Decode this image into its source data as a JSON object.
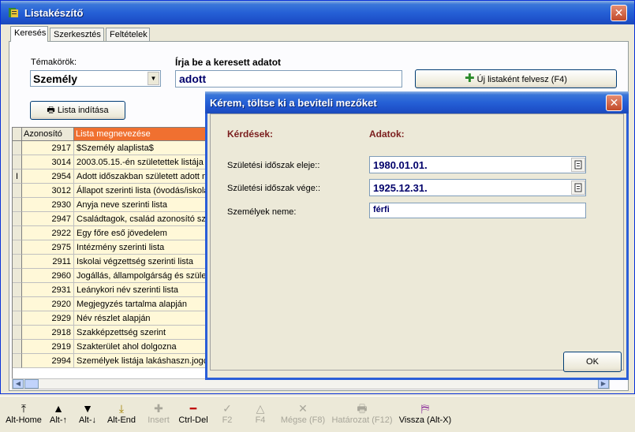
{
  "window": {
    "title": "Listakészítő"
  },
  "tabs": [
    {
      "label": "Keresés"
    },
    {
      "label": "Szerkesztés"
    },
    {
      "label": "Feltételek"
    }
  ],
  "search": {
    "topics_label": "Témakörök:",
    "topic_value": "Személy",
    "query_label": "Írja be a keresett adatot",
    "query_value": "adott",
    "new_list_label": "Új listaként felvesz  (F4)",
    "run_list_label": "Lista indítása"
  },
  "grid": {
    "columns": [
      "Azonosító",
      "Lista megnevezése"
    ],
    "rows": [
      {
        "id": "2917",
        "name": "$Személy alaplista$",
        "indicator": ""
      },
      {
        "id": "3014",
        "name": "2003.05.15.-én születettek listája",
        "indicator": ""
      },
      {
        "id": "2954",
        "name": "Adott időszakban született adott ne",
        "indicator": "I"
      },
      {
        "id": "3012",
        "name": "Állapot szerinti lista (óvodás/iskolás",
        "indicator": ""
      },
      {
        "id": "2930",
        "name": "Anyja neve szerinti lista",
        "indicator": ""
      },
      {
        "id": "2947",
        "name": "Családtagok, család azonosító szár",
        "indicator": ""
      },
      {
        "id": "2922",
        "name": "Egy főre eső jövedelem",
        "indicator": ""
      },
      {
        "id": "2975",
        "name": "Intézmény szerinti lista",
        "indicator": ""
      },
      {
        "id": "2911",
        "name": "Iskolai végzettség szerinti lista",
        "indicator": ""
      },
      {
        "id": "2960",
        "name": "Jogállás, állampolgárság és születé:",
        "indicator": ""
      },
      {
        "id": "2931",
        "name": "Leánykori név szerinti lista",
        "indicator": ""
      },
      {
        "id": "2920",
        "name": "Megjegyzés tartalma alapján",
        "indicator": ""
      },
      {
        "id": "2929",
        "name": "Név részlet alapján",
        "indicator": ""
      },
      {
        "id": "2918",
        "name": "Szakképzettség szerint",
        "indicator": ""
      },
      {
        "id": "2919",
        "name": "Szakterület ahol dolgozna",
        "indicator": ""
      },
      {
        "id": "2994",
        "name": "Személyek listája lakáshaszn.jogcír",
        "indicator": ""
      }
    ]
  },
  "dialog": {
    "title": "Kérem, töltse ki a beviteli mezőket",
    "col_questions": "Kérdések:",
    "col_data": "Adatok:",
    "fields": [
      {
        "label": "Születési időszak eleje::",
        "value": "1980.01.01."
      },
      {
        "label": "Születési időszak vége::",
        "value": "1925.12.31."
      },
      {
        "label": "Személyek neme:",
        "value": "férfi"
      }
    ],
    "ok_label": "OK"
  },
  "toolbar": [
    {
      "label": "Alt-Home",
      "icon": "to-first-icon"
    },
    {
      "label": "Alt-↑",
      "icon": "arrow-up-icon"
    },
    {
      "label": "Alt-↓",
      "icon": "arrow-down-icon"
    },
    {
      "label": "Alt-End",
      "icon": "to-last-icon"
    },
    {
      "label": "Insert",
      "icon": "plus-icon"
    },
    {
      "label": "Ctrl-Del",
      "icon": "minus-icon"
    },
    {
      "label": "F2",
      "icon": "check-icon"
    },
    {
      "label": "F4",
      "icon": "triangle-up-icon"
    },
    {
      "label": "Mégse (F8)",
      "icon": "x-icon"
    },
    {
      "label": "Határozat (F12)",
      "icon": "printer-icon"
    },
    {
      "label": "Vissza (Alt-X)",
      "icon": "exit-icon"
    }
  ],
  "colors": {
    "title_blue": "#2560d6",
    "header_orange": "#f07030",
    "row_yellow": "#fff8d8",
    "dialog_heading": "#7b1e1e"
  }
}
